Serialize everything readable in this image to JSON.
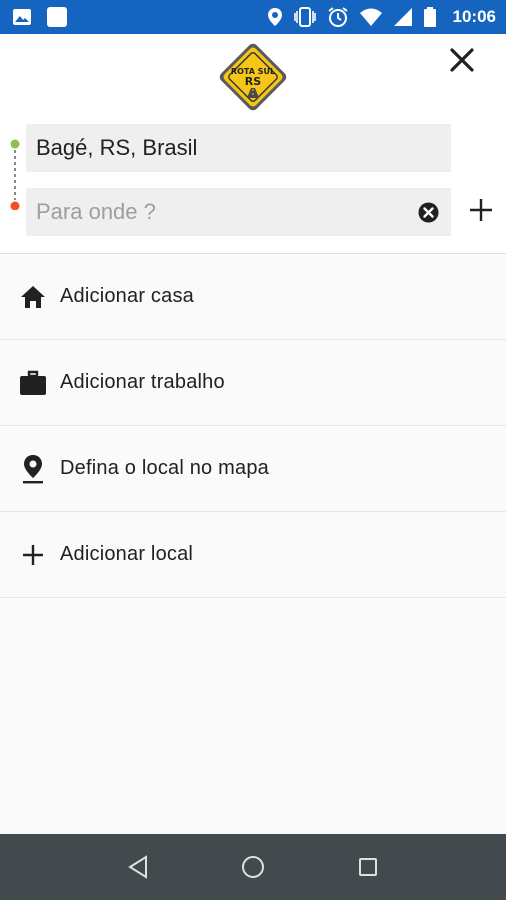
{
  "status_bar": {
    "time": "10:06",
    "icons_left": [
      "image-icon",
      "app-icon"
    ],
    "icons_right": [
      "location-icon",
      "vibrate-icon",
      "alarm-icon",
      "wifi-icon",
      "signal-icon",
      "battery-icon"
    ]
  },
  "header": {
    "logo_text": "ROTA SUL RS",
    "close_icon": "close-icon"
  },
  "route": {
    "origin_value": "Bagé, RS, Brasil",
    "destination_placeholder": "Para onde ?",
    "destination_value": ""
  },
  "list": {
    "items": [
      {
        "label": "Adicionar casa",
        "icon": "home-icon"
      },
      {
        "label": "Adicionar trabalho",
        "icon": "briefcase-icon"
      },
      {
        "label": "Defina o local no mapa",
        "icon": "map-pin-icon"
      },
      {
        "label": "Adicionar local",
        "icon": "plus-icon"
      }
    ]
  },
  "colors": {
    "status_bar": "#1565c0",
    "origin_dot": "#8bc34a",
    "destination_dot": "#f4511e",
    "nav_bar": "#424a4e",
    "logo_yellow": "#f5c518"
  }
}
